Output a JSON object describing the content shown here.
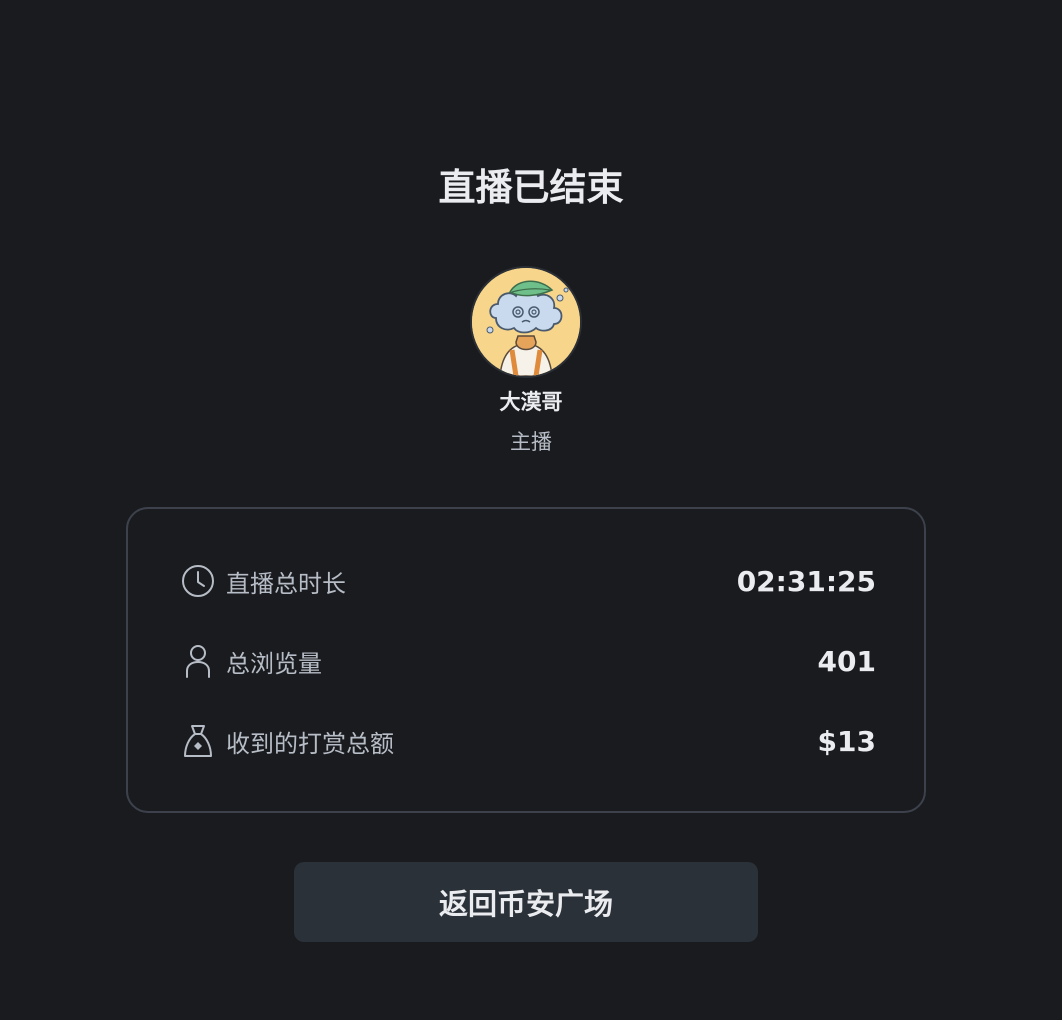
{
  "page": {
    "title": "直播已结束"
  },
  "host": {
    "name": "大漠哥",
    "role": "主播",
    "avatar_icon": "cloud-character-avatar"
  },
  "stats": [
    {
      "icon": "clock-icon",
      "label": "直播总时长",
      "value": "02:31:25"
    },
    {
      "icon": "user-icon",
      "label": "总浏览量",
      "value": "401"
    },
    {
      "icon": "money-bag-icon",
      "label": "收到的打赏总额",
      "value": "$13"
    }
  ],
  "actions": {
    "back_label": "返回币安广场"
  },
  "colors": {
    "background": "#1a1b1f",
    "card_border": "#3c414b",
    "button_bg": "#2b3139",
    "text_primary": "#eaecef",
    "text_secondary": "#b7bdc6",
    "avatar_bg": "#f7d58a"
  }
}
